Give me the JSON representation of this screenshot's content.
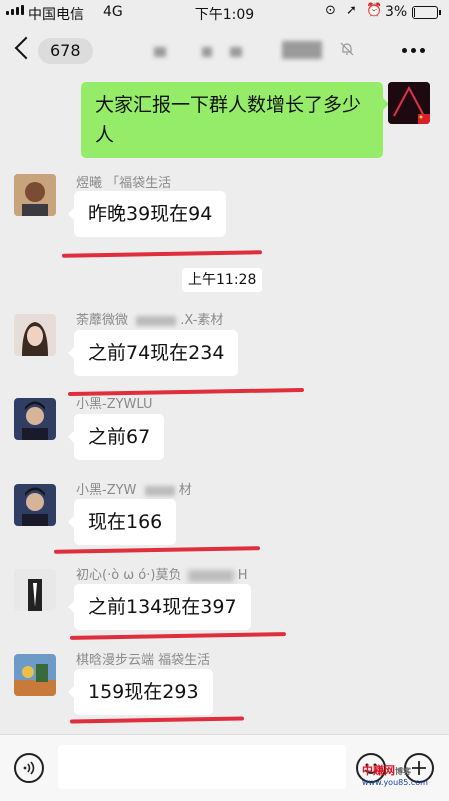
{
  "status": {
    "carrier": "中国电信",
    "network": "4G",
    "time": "下午1:09",
    "battery": "3%",
    "battery_level": 0.03
  },
  "nav": {
    "back_count": "678"
  },
  "chat": {
    "my_message": "大家汇报一下群人数增长了多少人",
    "time_divider": "上午11:28",
    "messages": [
      {
        "sender": "煜曦 「福袋生活",
        "text": "昨晚39现在94"
      },
      {
        "sender": "荼蘼微微",
        "sender_tail": ".X-素材",
        "text": "之前74现在234"
      },
      {
        "sender": "小黑-ZYWLU",
        "text": "之前67"
      },
      {
        "sender": "小黑-ZYW",
        "sender_tail": "材",
        "text": "现在166"
      },
      {
        "sender": "初心(·ò ω ó·)莫负",
        "sender_tail": "H",
        "text": "之前134现在397"
      },
      {
        "sender": "棋晗漫步云端  福袋生活",
        "text": "159现在293"
      }
    ]
  },
  "watermark": {
    "brand": "中赚网",
    "suffix": "博客",
    "url": "www.you85.com"
  }
}
